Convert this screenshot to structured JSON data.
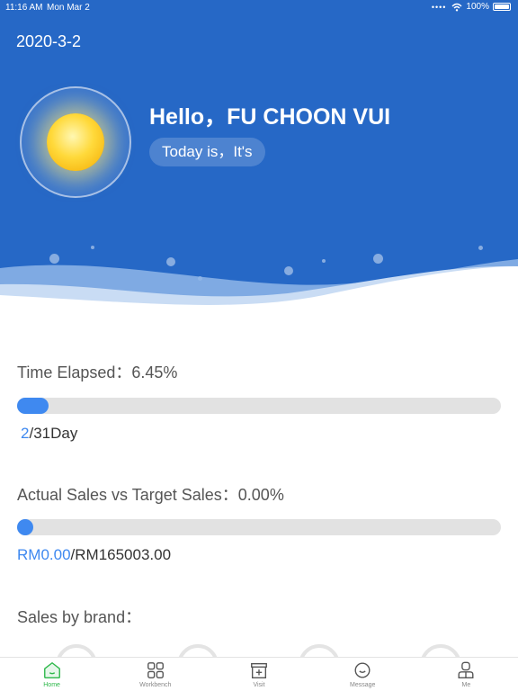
{
  "status_bar": {
    "time": "11:16 AM",
    "date": "Mon Mar 2",
    "battery": "100%"
  },
  "hero": {
    "date": "2020-3-2",
    "greeting": "Hello，FU CHOON VUI",
    "today_text": "Today is，It's",
    "weather_icon": "sun-icon"
  },
  "time_elapsed": {
    "label": "Time Elapsed：6.45%",
    "progress": 0.0645,
    "current_day": "2",
    "total_days": "/31Day"
  },
  "sales": {
    "label": "Actual Sales vs Target Sales：0.00%",
    "progress": 0.0,
    "actual": "RM0.00",
    "target": "/RM165003.00"
  },
  "brand_section": {
    "title": "Sales by brand："
  },
  "tabs": [
    {
      "label": "Home",
      "icon": "home-icon",
      "active": true
    },
    {
      "label": "Workbench",
      "icon": "grid-icon",
      "active": false
    },
    {
      "label": "Visit",
      "icon": "store-icon",
      "active": false
    },
    {
      "label": "Message",
      "icon": "message-icon",
      "active": false
    },
    {
      "label": "Me",
      "icon": "user-icon",
      "active": false
    }
  ],
  "colors": {
    "primary_blue": "#2668c6",
    "accent_blue": "#3f89f0",
    "active_tab": "#2db84a"
  }
}
